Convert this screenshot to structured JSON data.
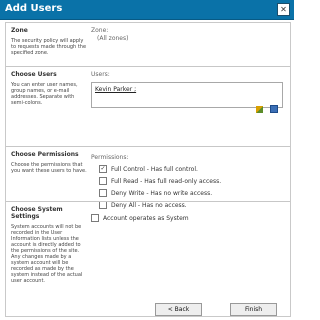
{
  "window": {
    "title": "Add Users"
  },
  "zone": {
    "heading": "Zone",
    "description": "The security policy will apply to requests made through the specified zone.",
    "label": "Zone:",
    "value": "(All zones)"
  },
  "users": {
    "heading": "Choose Users",
    "description": "You can enter user names, group names, or e-mail addresses. Separate with semi-colons.",
    "label": "Users:",
    "entry": "Kevin Parker ;"
  },
  "permissions": {
    "heading": "Choose Permissions",
    "description": "Choose the permissions that you want these users to have.",
    "label": "Permissions:",
    "options": [
      {
        "label": "Full Control - Has full control.",
        "checked": true
      },
      {
        "label": "Full Read - Has full read-only access.",
        "checked": false
      },
      {
        "label": "Deny Write - Has no write access.",
        "checked": false
      },
      {
        "label": "Deny All - Has no access.",
        "checked": false
      }
    ]
  },
  "system": {
    "heading": "Choose System Settings",
    "description": "System accounts will not be recorded in the User Information lists unless the account is directly added to the permissions of the site. Any changes made by a system account will be recorded as made by the system instead of the actual user account.",
    "option": "Account operates as System"
  },
  "buttons": {
    "back": "< Back",
    "finish": "Finish"
  }
}
